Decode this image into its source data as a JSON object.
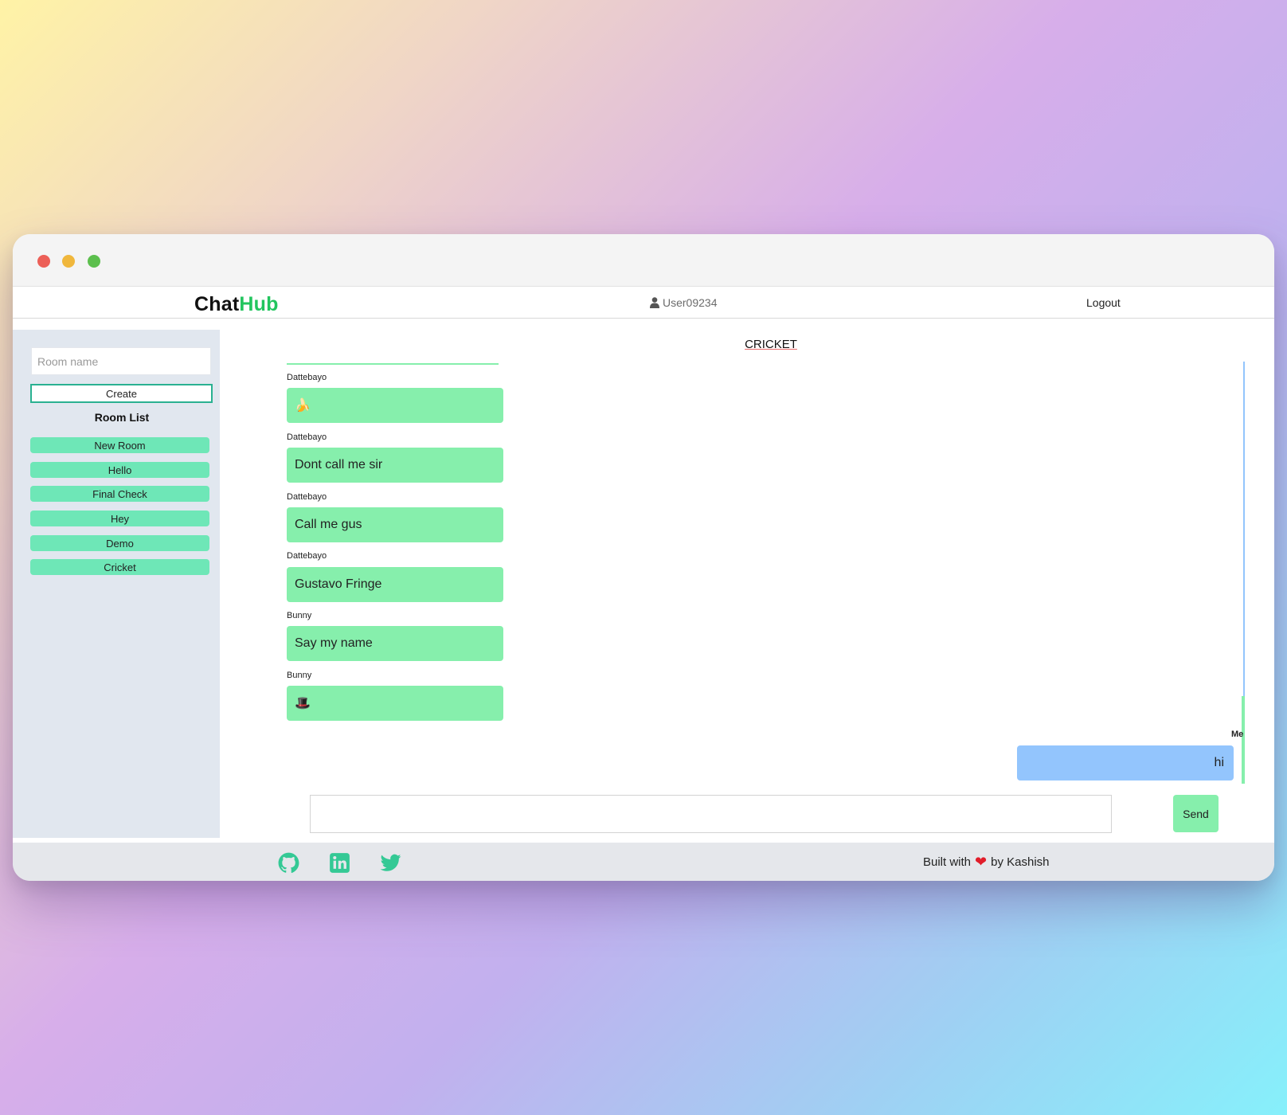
{
  "navbar": {
    "brand_part1": "Chat",
    "brand_part2": "Hub",
    "username": "User09234",
    "user_icon": "user-icon",
    "logout_label": "Logout"
  },
  "sidebar": {
    "room_input_placeholder": "Room name",
    "create_label": "Create",
    "room_list_title": "Room List",
    "rooms": [
      "New Room",
      "Hello",
      "Final Check",
      "Hey",
      "Demo",
      "Cricket"
    ]
  },
  "chat": {
    "title": "CRICKET",
    "messages": [
      {
        "sender": "Dattebayo",
        "text": "🍌"
      },
      {
        "sender": "Dattebayo",
        "text": "Dont call me sir"
      },
      {
        "sender": "Dattebayo",
        "text": "Call me gus"
      },
      {
        "sender": "Dattebayo",
        "text": "Gustavo Fringe"
      },
      {
        "sender": "Bunny",
        "text": "Say my name"
      },
      {
        "sender": "Bunny",
        "text": "🎩"
      }
    ],
    "my_message": {
      "sender": "Me",
      "text": "hi"
    },
    "input_value": "",
    "send_label": "Send"
  },
  "footer": {
    "socials": [
      "github-icon",
      "linkedin-icon",
      "twitter-icon"
    ],
    "credit_prefix": "Built with",
    "credit_suffix": "by Kashish",
    "heart_icon": "heart-icon"
  },
  "colors": {
    "brand_accent": "#22c55e",
    "room_button": "#6ee7b7",
    "incoming_bubble": "#86efac",
    "outgoing_bubble": "#93c5fd",
    "sidebar_bg": "#e1e7ef",
    "footer_icon": "#34c995"
  }
}
